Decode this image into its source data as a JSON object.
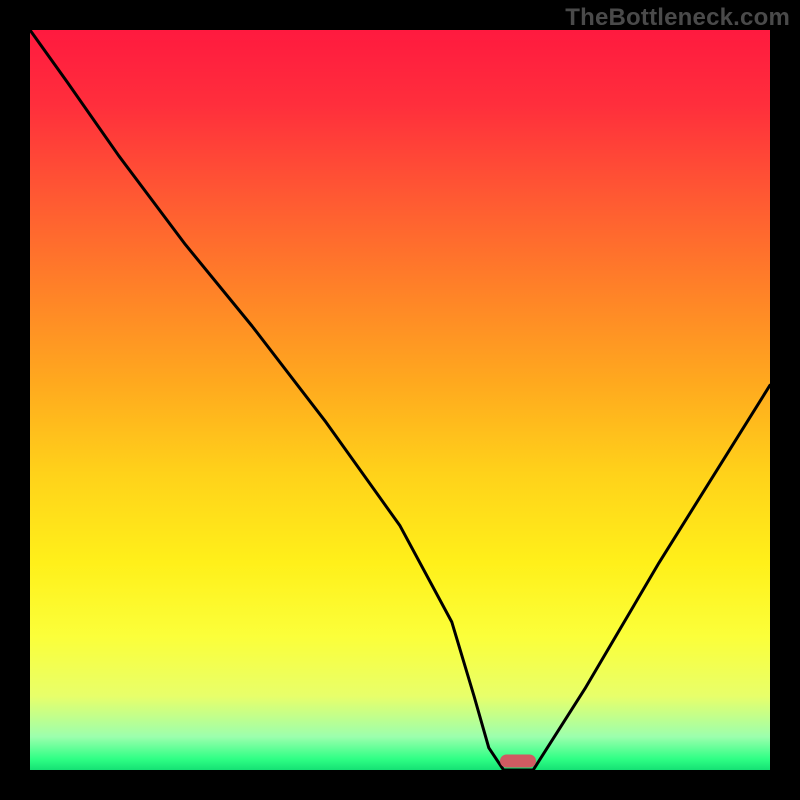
{
  "watermark": "TheBottleneck.com",
  "chart_data": {
    "type": "line",
    "title": "",
    "xlabel": "",
    "ylabel": "",
    "xlim": [
      0,
      100
    ],
    "ylim": [
      0,
      100
    ],
    "series": [
      {
        "name": "bottleneck-curve",
        "x": [
          0,
          5,
          12,
          21,
          30,
          40,
          50,
          57,
          60,
          62,
          64,
          68,
          75,
          85,
          95,
          100
        ],
        "y": [
          100,
          93,
          83,
          71,
          60,
          47,
          33,
          20,
          10,
          3,
          0,
          0,
          11,
          28,
          44,
          52
        ]
      }
    ],
    "marker": {
      "x": 66,
      "y": 1.2,
      "color": "#cf5b62"
    },
    "gradient_stops": [
      {
        "pos": 0.0,
        "color": "#ff1a3f"
      },
      {
        "pos": 0.1,
        "color": "#ff2e3c"
      },
      {
        "pos": 0.22,
        "color": "#ff5733"
      },
      {
        "pos": 0.35,
        "color": "#ff8128"
      },
      {
        "pos": 0.48,
        "color": "#ffaa1e"
      },
      {
        "pos": 0.6,
        "color": "#ffd21a"
      },
      {
        "pos": 0.72,
        "color": "#fff01a"
      },
      {
        "pos": 0.82,
        "color": "#fbff3a"
      },
      {
        "pos": 0.9,
        "color": "#e8ff6a"
      },
      {
        "pos": 0.955,
        "color": "#9cffad"
      },
      {
        "pos": 0.985,
        "color": "#2fff85"
      },
      {
        "pos": 1.0,
        "color": "#15e174"
      }
    ]
  }
}
